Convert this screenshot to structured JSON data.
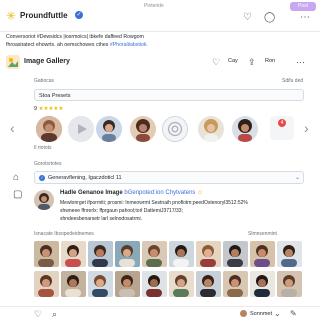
{
  "app": {
    "title": "Pinteride",
    "profile_name": "Proundfuttle",
    "action_label": "Post"
  },
  "post": {
    "line1": "Conversoriot #Dewsidcs |iosrmoics| ibkefe daffeed Rowgom",
    "line2": "fhroasiratect ehowrts. ah oemschowes cthes",
    "line2_link": "#Phoraliiabstiok."
  },
  "gallery": {
    "title": "Image Gallery",
    "actions": [
      "Cay",
      "Ron"
    ],
    "section_label": "Gabocas",
    "section_right": "Sdifu ded",
    "search_value": "Stoa  Presets",
    "rating_prefix": "9",
    "rating_stars": "★★★★★",
    "profiles_count": "Il  riotots",
    "faces_label": "Gorotsrtotes",
    "badge_count": "4"
  },
  "generating": {
    "dropdown_value": "Generavflening,  Igaczdoticl 11",
    "title_prefix": "Hadle Genanoe Image",
    "title_link": "bGenpoted:ion Chytvatens",
    "line1": "Mewlonrget  ifpormiti; prosmi: Inmeowrmt  Sestnaih pnoflotm;peedOstenoryl3512:52%",
    "line2": "shwneee  ffnrerlx: ffprgaun pahool;torl DattemiJ3717/33;",
    "line3": "shndeesbenarsetr  larl selnodosatrmi."
  },
  "grid": {
    "header_left": "Isnacate  Ibsopedeidnemes",
    "header_right": "Slmnsenmint"
  },
  "bottombar": {
    "right_label": "Sonnmet"
  },
  "icons": {
    "brand": "sparkle-icon",
    "verified": "verified-badge-icon",
    "heart": "heart-icon",
    "chat": "chat-icon",
    "menu": "menu-icon",
    "upload": "upload-icon"
  },
  "colors": {
    "accent_purple": "#c9a6f0",
    "link_blue": "#3b6fd8",
    "star_gold": "#f2b705",
    "badge_red": "#e84a4a"
  }
}
